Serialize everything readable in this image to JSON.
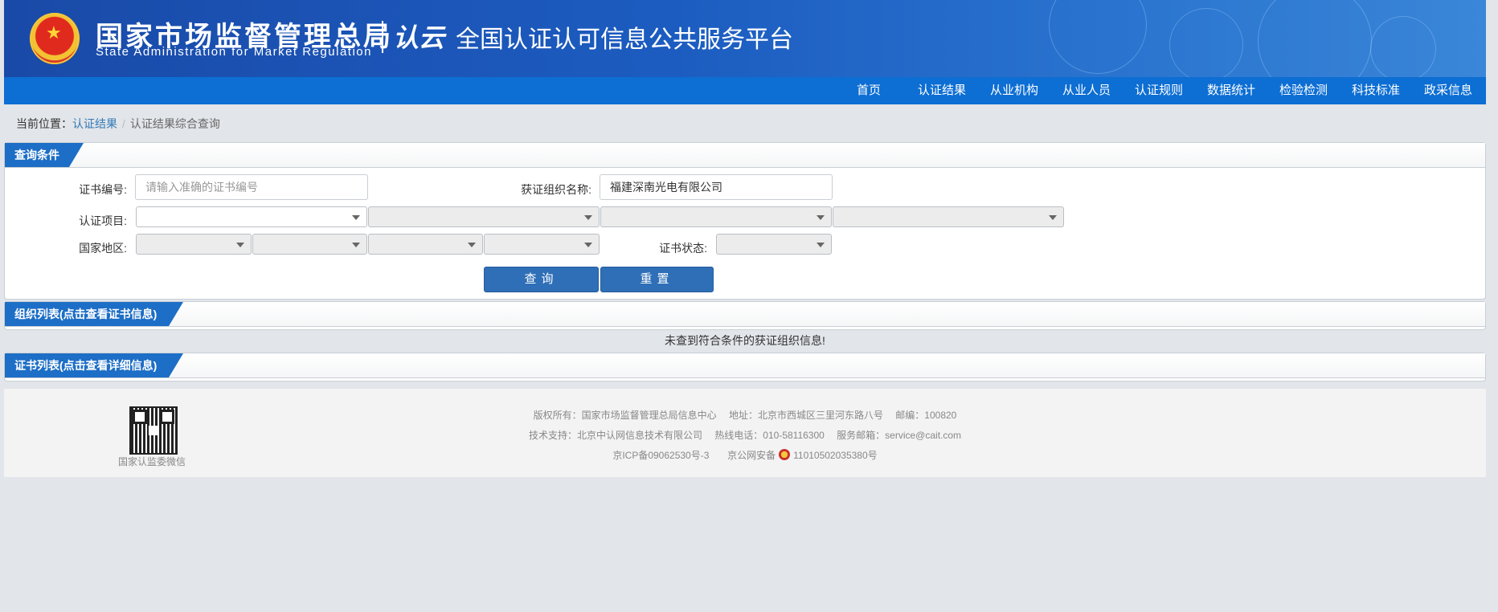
{
  "header": {
    "agency_cn": "国家市场监督管理总局",
    "agency_en": "State Administration  for  Market Regulation",
    "logo_text": "认云",
    "platform": "全国认证认可信息公共服务平台"
  },
  "nav": {
    "items": [
      "首页",
      "认证结果",
      "从业机构",
      "从业人员",
      "认证规则",
      "数据统计",
      "检验检测",
      "科技标准",
      "政采信息"
    ]
  },
  "breadcrumb": {
    "prefix": "当前位置：",
    "link": "认证结果",
    "separator": "/",
    "current": "认证结果综合查询"
  },
  "query_panel": {
    "title": "查询条件",
    "cert_no_label": "证书编号:",
    "cert_no_placeholder": "请输入准确的证书编号",
    "cert_no_value": "",
    "org_name_label": "获证组织名称:",
    "org_name_value": "福建深南光电有限公司",
    "project_label": "认证项目:",
    "region_label": "国家地区:",
    "status_label": "证书状态:",
    "query_button": "查询",
    "reset_button": "重置"
  },
  "org_panel": {
    "title": "组织列表(点击查看证书信息)",
    "empty_message": "未查到符合条件的获证组织信息!"
  },
  "cert_panel": {
    "title": "证书列表(点击查看详细信息)"
  },
  "footer": {
    "qr_label": "国家认监委微信",
    "line1": "版权所有：国家市场监督管理总局信息中心　 地址：北京市西城区三里河东路八号　 邮编：100820",
    "line2": "技术支持：北京中认网信息技术有限公司　 热线电话：010-58116300　 服务邮箱：service@cait.com",
    "icp": "京ICP备09062530号-3",
    "police_prefix": "京公网安备",
    "police_no": "11010502035380号"
  },
  "colors": {
    "banner": "#1c5cc0",
    "nav": "#0d6ed3",
    "panel_tab": "#1d6ec6",
    "button": "#2f6fb7",
    "page_bg": "#e2e5e9"
  }
}
